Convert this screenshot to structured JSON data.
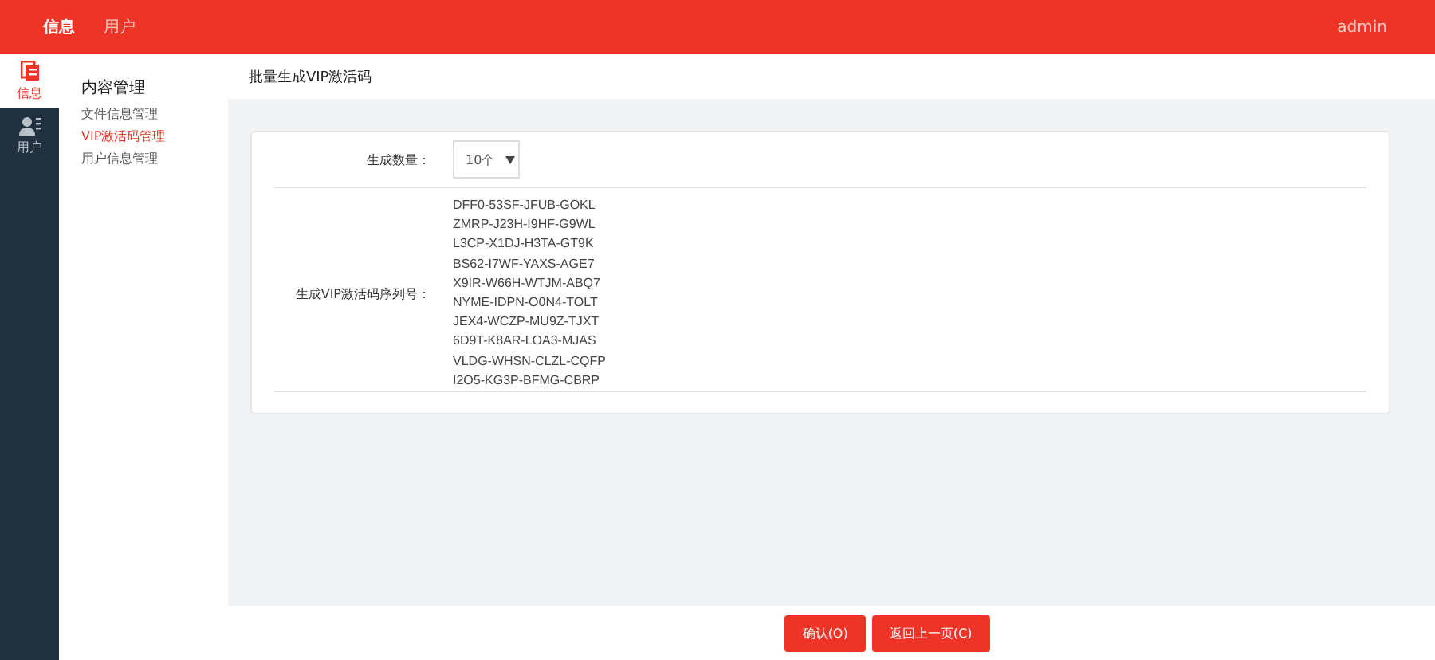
{
  "top_nav": [
    {
      "label": "信息",
      "selected": true
    },
    {
      "label": "用户",
      "selected": false
    }
  ],
  "user": "admin",
  "icon_sidebar": [
    {
      "label": "信息",
      "kind": "docs",
      "selected": true
    },
    {
      "label": "用户",
      "kind": "user",
      "selected": false
    }
  ],
  "menu": {
    "title": "内容管理",
    "items": [
      {
        "label": "文件信息管理",
        "selected": false
      },
      {
        "label": "VIP激活码管理",
        "selected": true
      },
      {
        "label": "用户信息管理",
        "selected": false
      }
    ]
  },
  "page_title": "批量生成VIP激活码",
  "form": {
    "count_label": "生成数量：",
    "count_value": "10个",
    "codes_label": "生成VIP激活码序列号：",
    "codes": [
      "DFF0-53SF-JFUB-GOKL",
      "ZMRP-J23H-I9HF-G9WL",
      "L3CP-X1DJ-H3TA-GT9K",
      "BS62-I7WF-YAXS-AGE7",
      "X9IR-W66H-WTJM-ABQ7",
      "NYME-IDPN-O0N4-TOLT",
      "JEX4-WCZP-MU9Z-TJXT",
      "6D9T-K8AR-LOA3-MJAS",
      "VLDG-WHSN-CLZL-CQFP",
      "I2O5-KG3P-BFMG-CBRP"
    ]
  },
  "buttons": [
    "确认(O)",
    "返回上一页(C)"
  ]
}
